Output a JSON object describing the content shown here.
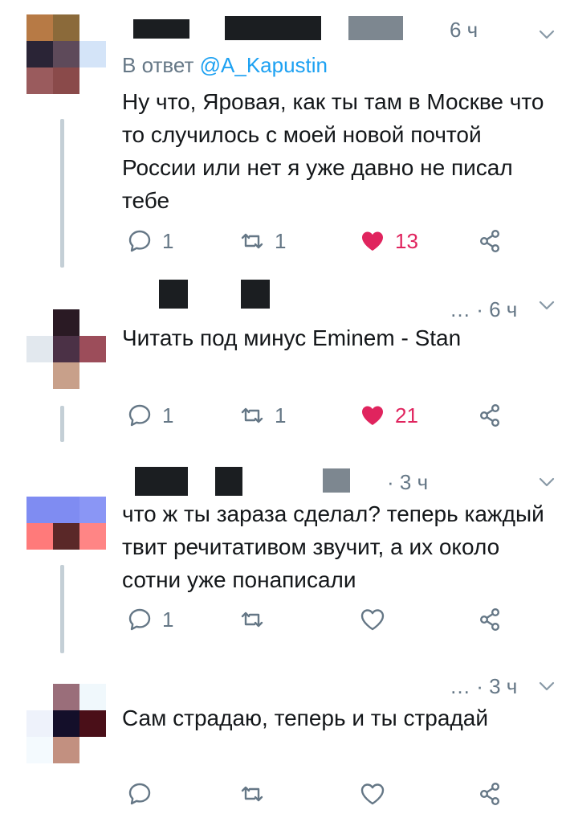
{
  "tweets": [
    {
      "time": "6 ч",
      "reply_prefix": "В ответ ",
      "reply_handle": "@A_Kapustin",
      "text": "Ну что, Яровая, как ты там в Москве что то случилось с моей новой почтой России или нет я уже давно не писал тебе",
      "replies": "1",
      "retweets": "1",
      "likes": "13",
      "liked": true
    },
    {
      "time": "… · 6 ч",
      "text": "Читать под минус Eminem - Stan",
      "replies": "1",
      "retweets": "1",
      "likes": "21",
      "liked": true
    },
    {
      "time": "· 3 ч",
      "text": "что ж ты зараза сделал? теперь каждый твит речитативом звучит, а их около сотни уже понаписали",
      "replies": "1",
      "retweets": "",
      "likes": "",
      "liked": false
    },
    {
      "time": "… · 3 ч",
      "text": "Сам страдаю, теперь и ты страдай",
      "replies": "",
      "retweets": "",
      "likes": "",
      "liked": false
    }
  ],
  "colors": {
    "like": "#e0245e",
    "link": "#1da1f2",
    "muted": "#657786"
  },
  "icons": [
    "reply-icon",
    "retweet-icon",
    "like-icon",
    "share-icon",
    "chevron-down-icon"
  ]
}
